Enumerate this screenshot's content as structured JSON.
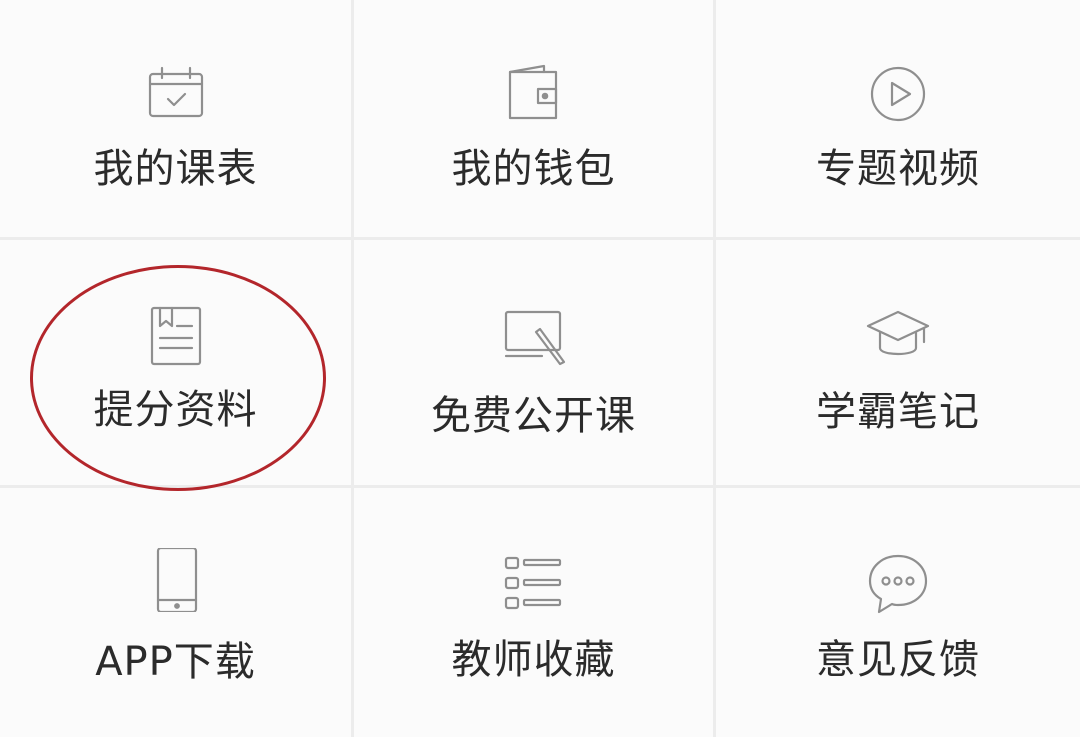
{
  "menu": {
    "items": [
      {
        "id": "schedule",
        "label": "我的课表",
        "icon": "calendar-check-icon"
      },
      {
        "id": "wallet",
        "label": "我的钱包",
        "icon": "wallet-icon"
      },
      {
        "id": "videos",
        "label": "专题视频",
        "icon": "play-circle-icon"
      },
      {
        "id": "materials",
        "label": "提分资料",
        "icon": "bookmark-document-icon"
      },
      {
        "id": "free-course",
        "label": "免费公开课",
        "icon": "laptop-pen-icon"
      },
      {
        "id": "notes",
        "label": "学霸笔记",
        "icon": "graduation-cap-icon"
      },
      {
        "id": "app-download",
        "label": "APP下载",
        "icon": "mobile-phone-icon"
      },
      {
        "id": "teacher-favorites",
        "label": "教师收藏",
        "icon": "list-icon"
      },
      {
        "id": "feedback",
        "label": "意见反馈",
        "icon": "chat-bubble-icon"
      }
    ]
  },
  "annotation": {
    "color": "#b3262b",
    "target": "materials"
  },
  "colors": {
    "icon": "#8f8f8f",
    "label": "#2b2b2b",
    "cell_bg": "#fbfbfb",
    "divider": "#ececec"
  }
}
